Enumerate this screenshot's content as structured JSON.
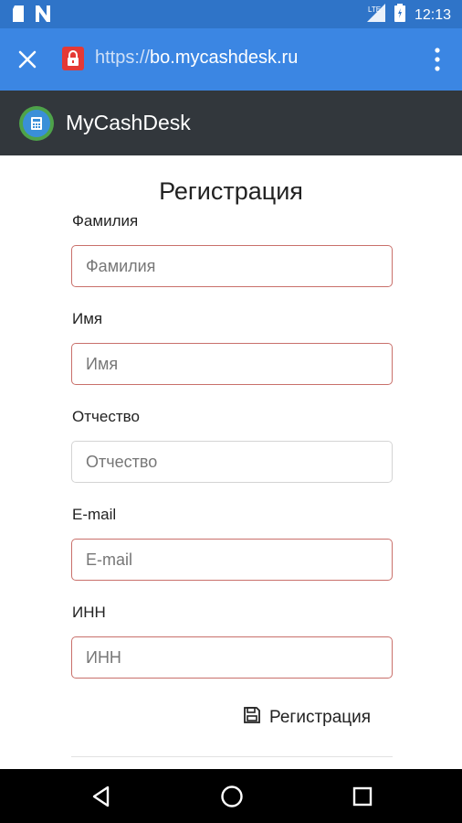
{
  "status_bar": {
    "time": "12:13",
    "icons": [
      "sd-card-icon",
      "n-notification-icon",
      "signal-icon",
      "battery-icon"
    ]
  },
  "browser": {
    "url_protocol": "https://",
    "url_host": "bo.mycashdesk.ru",
    "accent_color": "#3b86e3",
    "lock_color": "#e53935"
  },
  "app": {
    "title": "MyCashDesk",
    "bar_color": "#32373c"
  },
  "form": {
    "title": "Регистрация",
    "fields": [
      {
        "label": "Фамилия",
        "placeholder": "Фамилия",
        "value": ""
      },
      {
        "label": "Имя",
        "placeholder": "Имя",
        "value": ""
      },
      {
        "label": "Отчество",
        "placeholder": "Отчество",
        "value": ""
      },
      {
        "label": "E-mail",
        "placeholder": "E-mail",
        "value": ""
      },
      {
        "label": "ИНН",
        "placeholder": "ИНН",
        "value": ""
      }
    ],
    "submit_label": "Регистрация",
    "invalid_border_color": "#c9706b"
  },
  "nav": {
    "buttons": [
      "back-icon",
      "home-icon",
      "recents-icon"
    ]
  }
}
